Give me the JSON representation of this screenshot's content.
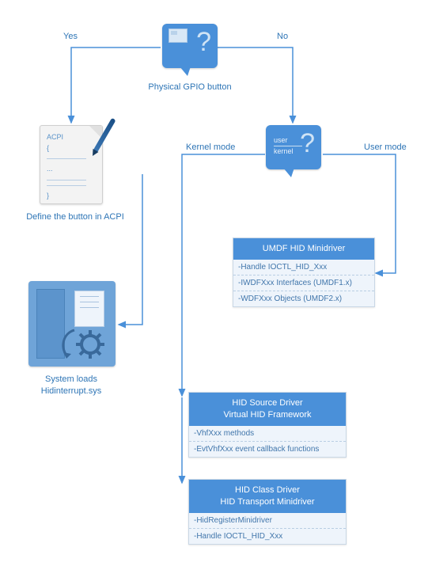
{
  "decision_top": {
    "label": "Physical GPIO button",
    "yes": "Yes",
    "no": "No"
  },
  "decision_mode": {
    "user": "user",
    "kernel": "kernel",
    "kernel_mode": "Kernel mode",
    "user_mode": "User mode"
  },
  "acpi_node": {
    "header": "ACPI",
    "brace_open": "{",
    "dots": "...",
    "brace_close": "}",
    "caption": "Define the button in ACPI"
  },
  "load_node": {
    "caption_l1": "System loads",
    "caption_l2": "Hidinterrupt.sys"
  },
  "umdf_box": {
    "title": "UMDF HID Minidriver",
    "rows": [
      "-Handle IOCTL_HID_Xxx",
      "-IWDFXxx Interfaces (UMDF1.x)",
      "-WDFXxx Objects (UMDF2.x)"
    ]
  },
  "vhf_box": {
    "title_l1": "HID Source Driver",
    "title_l2": "Virtual HID Framework",
    "rows": [
      "-VhfXxx methods",
      "-EvtVhfXxx event callback functions"
    ]
  },
  "class_box": {
    "title_l1": "HID Class Driver",
    "title_l2": "HID Transport Minidriver",
    "rows": [
      "-HidRegisterMinidriver",
      "-Handle IOCTL_HID_Xxx"
    ]
  }
}
